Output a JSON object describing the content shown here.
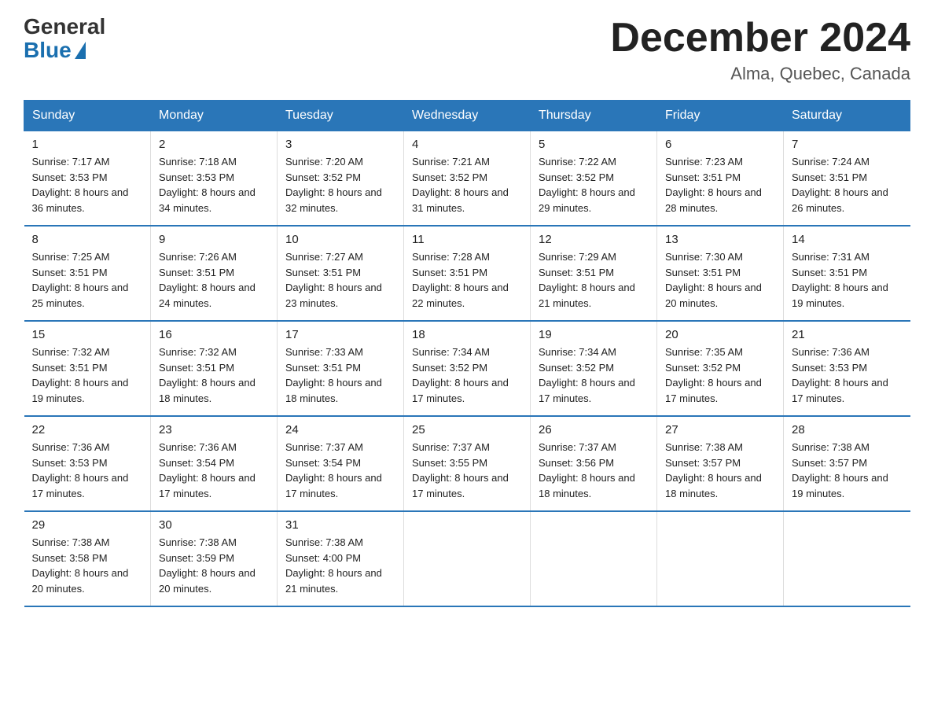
{
  "header": {
    "logo_general": "General",
    "logo_blue": "Blue",
    "title": "December 2024",
    "subtitle": "Alma, Quebec, Canada"
  },
  "days_of_week": [
    "Sunday",
    "Monday",
    "Tuesday",
    "Wednesday",
    "Thursday",
    "Friday",
    "Saturday"
  ],
  "weeks": [
    [
      {
        "day": "1",
        "sunrise": "7:17 AM",
        "sunset": "3:53 PM",
        "daylight": "8 hours and 36 minutes."
      },
      {
        "day": "2",
        "sunrise": "7:18 AM",
        "sunset": "3:53 PM",
        "daylight": "8 hours and 34 minutes."
      },
      {
        "day": "3",
        "sunrise": "7:20 AM",
        "sunset": "3:52 PM",
        "daylight": "8 hours and 32 minutes."
      },
      {
        "day": "4",
        "sunrise": "7:21 AM",
        "sunset": "3:52 PM",
        "daylight": "8 hours and 31 minutes."
      },
      {
        "day": "5",
        "sunrise": "7:22 AM",
        "sunset": "3:52 PM",
        "daylight": "8 hours and 29 minutes."
      },
      {
        "day": "6",
        "sunrise": "7:23 AM",
        "sunset": "3:51 PM",
        "daylight": "8 hours and 28 minutes."
      },
      {
        "day": "7",
        "sunrise": "7:24 AM",
        "sunset": "3:51 PM",
        "daylight": "8 hours and 26 minutes."
      }
    ],
    [
      {
        "day": "8",
        "sunrise": "7:25 AM",
        "sunset": "3:51 PM",
        "daylight": "8 hours and 25 minutes."
      },
      {
        "day": "9",
        "sunrise": "7:26 AM",
        "sunset": "3:51 PM",
        "daylight": "8 hours and 24 minutes."
      },
      {
        "day": "10",
        "sunrise": "7:27 AM",
        "sunset": "3:51 PM",
        "daylight": "8 hours and 23 minutes."
      },
      {
        "day": "11",
        "sunrise": "7:28 AM",
        "sunset": "3:51 PM",
        "daylight": "8 hours and 22 minutes."
      },
      {
        "day": "12",
        "sunrise": "7:29 AM",
        "sunset": "3:51 PM",
        "daylight": "8 hours and 21 minutes."
      },
      {
        "day": "13",
        "sunrise": "7:30 AM",
        "sunset": "3:51 PM",
        "daylight": "8 hours and 20 minutes."
      },
      {
        "day": "14",
        "sunrise": "7:31 AM",
        "sunset": "3:51 PM",
        "daylight": "8 hours and 19 minutes."
      }
    ],
    [
      {
        "day": "15",
        "sunrise": "7:32 AM",
        "sunset": "3:51 PM",
        "daylight": "8 hours and 19 minutes."
      },
      {
        "day": "16",
        "sunrise": "7:32 AM",
        "sunset": "3:51 PM",
        "daylight": "8 hours and 18 minutes."
      },
      {
        "day": "17",
        "sunrise": "7:33 AM",
        "sunset": "3:51 PM",
        "daylight": "8 hours and 18 minutes."
      },
      {
        "day": "18",
        "sunrise": "7:34 AM",
        "sunset": "3:52 PM",
        "daylight": "8 hours and 17 minutes."
      },
      {
        "day": "19",
        "sunrise": "7:34 AM",
        "sunset": "3:52 PM",
        "daylight": "8 hours and 17 minutes."
      },
      {
        "day": "20",
        "sunrise": "7:35 AM",
        "sunset": "3:52 PM",
        "daylight": "8 hours and 17 minutes."
      },
      {
        "day": "21",
        "sunrise": "7:36 AM",
        "sunset": "3:53 PM",
        "daylight": "8 hours and 17 minutes."
      }
    ],
    [
      {
        "day": "22",
        "sunrise": "7:36 AM",
        "sunset": "3:53 PM",
        "daylight": "8 hours and 17 minutes."
      },
      {
        "day": "23",
        "sunrise": "7:36 AM",
        "sunset": "3:54 PM",
        "daylight": "8 hours and 17 minutes."
      },
      {
        "day": "24",
        "sunrise": "7:37 AM",
        "sunset": "3:54 PM",
        "daylight": "8 hours and 17 minutes."
      },
      {
        "day": "25",
        "sunrise": "7:37 AM",
        "sunset": "3:55 PM",
        "daylight": "8 hours and 17 minutes."
      },
      {
        "day": "26",
        "sunrise": "7:37 AM",
        "sunset": "3:56 PM",
        "daylight": "8 hours and 18 minutes."
      },
      {
        "day": "27",
        "sunrise": "7:38 AM",
        "sunset": "3:57 PM",
        "daylight": "8 hours and 18 minutes."
      },
      {
        "day": "28",
        "sunrise": "7:38 AM",
        "sunset": "3:57 PM",
        "daylight": "8 hours and 19 minutes."
      }
    ],
    [
      {
        "day": "29",
        "sunrise": "7:38 AM",
        "sunset": "3:58 PM",
        "daylight": "8 hours and 20 minutes."
      },
      {
        "day": "30",
        "sunrise": "7:38 AM",
        "sunset": "3:59 PM",
        "daylight": "8 hours and 20 minutes."
      },
      {
        "day": "31",
        "sunrise": "7:38 AM",
        "sunset": "4:00 PM",
        "daylight": "8 hours and 21 minutes."
      },
      null,
      null,
      null,
      null
    ]
  ]
}
